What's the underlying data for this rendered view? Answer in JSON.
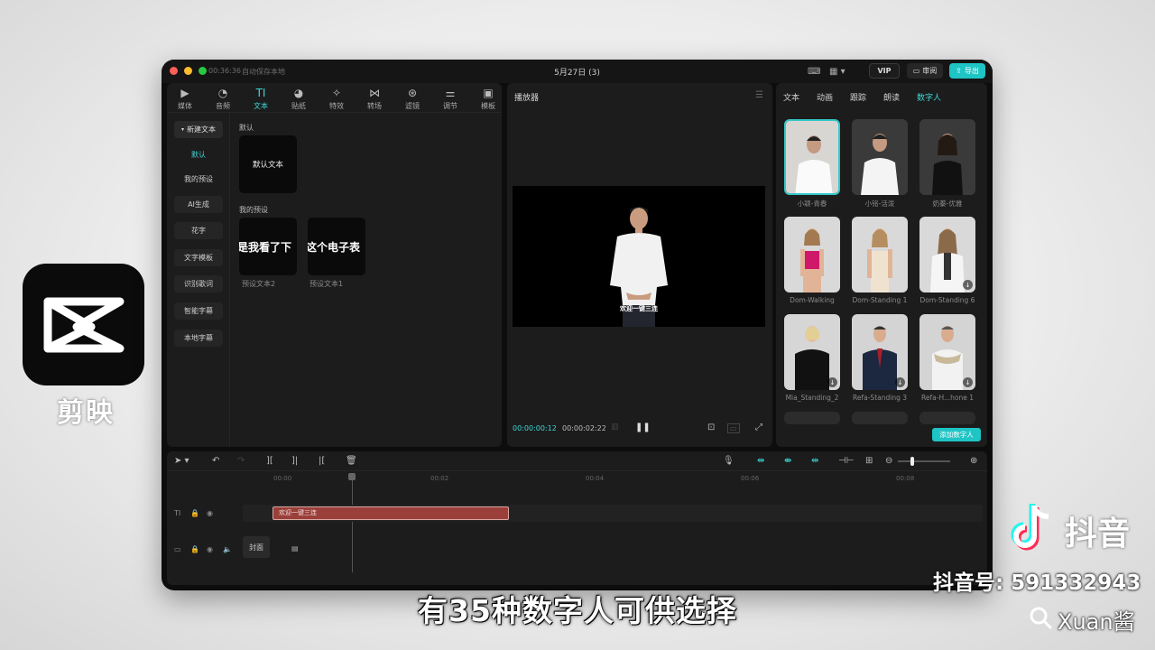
{
  "brand": {
    "name": "剪映",
    "logo_icon": "capcut-logo-icon"
  },
  "titlebar": {
    "time": "00:36:36",
    "autosave": "自动保存本地",
    "project_title": "5月27日 (3)",
    "vip_label": "VIP",
    "review_label": "审阅",
    "export_label": "导出"
  },
  "toolbar": {
    "items": [
      {
        "label": "媒体",
        "icon": "media-icon"
      },
      {
        "label": "音频",
        "icon": "audio-icon"
      },
      {
        "label": "文本",
        "icon": "text-icon",
        "active": true
      },
      {
        "label": "贴纸",
        "icon": "sticker-icon"
      },
      {
        "label": "特效",
        "icon": "effects-icon"
      },
      {
        "label": "转场",
        "icon": "transition-icon"
      },
      {
        "label": "滤镜",
        "icon": "filter-icon"
      },
      {
        "label": "调节",
        "icon": "adjust-icon"
      },
      {
        "label": "模板",
        "icon": "template-icon"
      }
    ]
  },
  "sidenav": {
    "items": [
      "新建文本",
      "默认",
      "我的预设",
      "AI生成",
      "花字",
      "文字模板",
      "识别歌词",
      "智能字幕",
      "本地字幕"
    ]
  },
  "text_panel": {
    "default_section": "默认",
    "default_card": "默认文本",
    "preset_section": "我的预设",
    "presets": [
      {
        "preview": "是我看了下",
        "caption": "预设文本2"
      },
      {
        "preview": "这个电子表",
        "caption": "预设文本1"
      }
    ]
  },
  "player": {
    "title": "播放器",
    "caption": "欢迎一键三连",
    "current_time": "00:00:00:12",
    "total_time": "00:00:02:22"
  },
  "right_panel": {
    "tabs": [
      "文本",
      "动画",
      "跟踪",
      "朗读",
      "数字人"
    ],
    "active_tab": "数字人",
    "avatars": [
      {
        "name": "小颖-青春",
        "download": false,
        "selected": true
      },
      {
        "name": "小铭-活泼",
        "download": false
      },
      {
        "name": "奶蓁-优雅",
        "download": false
      },
      {
        "name": "Dom-Walking",
        "download": false
      },
      {
        "name": "Dom-Standing 1",
        "download": false
      },
      {
        "name": "Dom-Standing 6",
        "download": true
      },
      {
        "name": "Mia_Standing_2",
        "download": true
      },
      {
        "name": "Refa-Standing 3",
        "download": true
      },
      {
        "name": "Refa-H...hone 1",
        "download": true
      }
    ],
    "add_button": "添加数字人"
  },
  "timeline": {
    "ruler": [
      "00:00",
      "00:02",
      "00:04",
      "00:06",
      "00:08"
    ],
    "clip_label": "欢迎一键三连",
    "cover_label": "封面"
  },
  "overlay": {
    "subtitle": "有35种数字人可供选择",
    "douyin_brand": "抖音",
    "douyin_id": "抖音号: 591332943",
    "username": "Xuan酱"
  },
  "colors": {
    "accent": "#1fc4c4",
    "clip": "#9a3f3a",
    "panel": "#1c1c1c"
  }
}
